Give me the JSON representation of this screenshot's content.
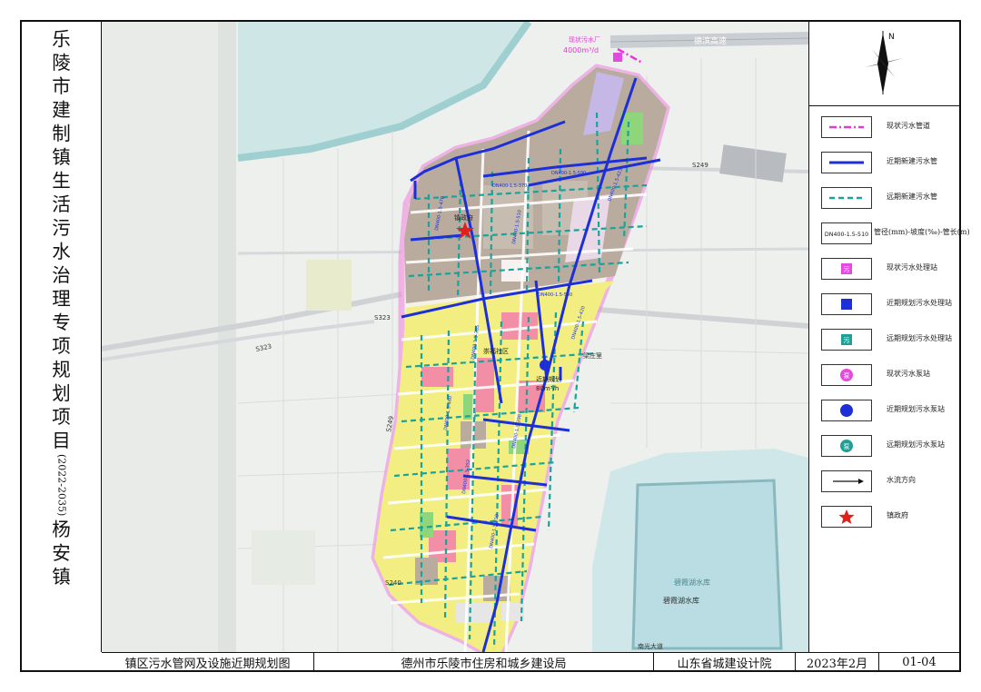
{
  "title_chars": [
    "乐",
    "陵",
    "市",
    "建",
    "制",
    "镇",
    "生",
    "活",
    "污",
    "水",
    "治",
    "理",
    "专",
    "项",
    "规",
    "划",
    "项",
    "目",
    "(2022-2035)",
    "杨",
    "安",
    "镇"
  ],
  "footer": {
    "drawing_name": "镇区污水管网及设施近期规划图",
    "authority": "德州市乐陵市住房和城乡建设局",
    "designer": "山东省城建设计院",
    "date": "2023年2月",
    "sheet_no": "01-04"
  },
  "compass_label": "N",
  "legend": [
    {
      "symbol": "dashdot-magenta-line",
      "label": "现状污水管道",
      "color": "#e23ad6"
    },
    {
      "symbol": "solid-blue-line",
      "label": "近期新建污水管",
      "color": "#1d2fd6"
    },
    {
      "symbol": "dashed-teal-line",
      "label": "远期新建污水管",
      "color": "#1aa39a"
    },
    {
      "symbol": "pipe-spec-box",
      "label": "管径(mm)-坡度(‰)-管长(m)",
      "box_text": "DN400-1.5-510"
    },
    {
      "symbol": "magenta-square",
      "label": "现状污水处理站",
      "glyph": "污",
      "color": "#e44ae0"
    },
    {
      "symbol": "blue-square",
      "label": "近期规划污水处理站",
      "color": "#1d2fd6"
    },
    {
      "symbol": "teal-square",
      "label": "远期规划污水处理站",
      "glyph": "污",
      "color": "#1f9f96"
    },
    {
      "symbol": "magenta-circle",
      "label": "现状污水泵站",
      "glyph": "泵",
      "color": "#e44ae0"
    },
    {
      "symbol": "blue-circle",
      "label": "近期规划污水泵站",
      "color": "#1d2fd6"
    },
    {
      "symbol": "teal-circle",
      "label": "远期规划污水泵站",
      "glyph": "泵",
      "color": "#1f9f96"
    },
    {
      "symbol": "arrow",
      "label": "水流方向"
    },
    {
      "symbol": "red-star",
      "label": "镇政府",
      "color": "#e0201a"
    }
  ],
  "map_labels": {
    "existing_plant_name": "现状污水厂",
    "existing_plant_capacity": "4000m³/d",
    "expressway": "德滨高速",
    "road_s249": "S249",
    "road_s323": "S323",
    "road_s323b": "S323",
    "road_s240": "S240",
    "road_s249b": "S249",
    "government": "镇政府",
    "community": "崇福社区",
    "pump_name": "近期规划",
    "pump_capacity": "80m³/h",
    "reservoir": "碧霞湖水库",
    "reservoir2": "碧霞湖水库",
    "village_a": "梁庄里",
    "road_south": "南光大道",
    "pipe_labels": [
      "DN400-1.5-370",
      "DN400-1.5-590",
      "DN400-1.5-478",
      "DN400-1.5-510",
      "DN400-1.5-423",
      "DN400-1.5-540",
      "DN400-1.5-385",
      "DN400-1.5-420",
      "DN400-1.5-460",
      "DN400-1.5-398",
      "DN400-1.5-352",
      "DN400-1.5-610"
    ]
  },
  "colors": {
    "magenta": "#e23ad6",
    "blue": "#1d2fd6",
    "teal": "#1aa39a",
    "residential": "#f2ee82",
    "industrial": "#b9ab9e",
    "commercial": "#f28fa6",
    "water": "#b8dbe3",
    "green": "#8fd67a"
  }
}
